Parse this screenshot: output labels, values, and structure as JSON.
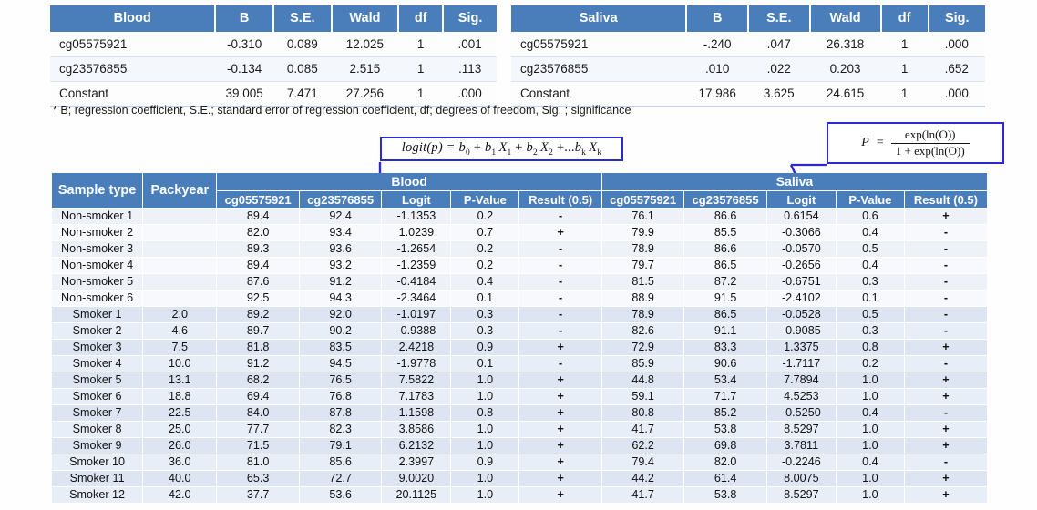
{
  "top_tables": [
    {
      "id": "blood",
      "headers": [
        "Blood",
        "B",
        "S.E.",
        "Wald",
        "df",
        "Sig."
      ],
      "rows": [
        [
          "cg05575921",
          "-0.310",
          "0.089",
          "12.025",
          "1",
          ".001"
        ],
        [
          "cg23576855",
          "-0.134",
          "0.085",
          "2.515",
          "1",
          ".113"
        ],
        [
          "Constant",
          "39.005",
          "7.471",
          "27.256",
          "1",
          ".000"
        ]
      ]
    },
    {
      "id": "saliva",
      "headers": [
        "Saliva",
        "B",
        "S.E.",
        "Wald",
        "df",
        "Sig."
      ],
      "rows": [
        [
          "cg05575921",
          "-.240",
          ".047",
          "26.318",
          "1",
          ".000"
        ],
        [
          "cg23576855",
          ".010",
          ".022",
          "0.203",
          "1",
          ".652"
        ],
        [
          "Constant",
          "17.986",
          "3.625",
          "24.615",
          "1",
          ".000"
        ]
      ]
    }
  ],
  "footnote": "* B; regression coefficient, S.E.; standard error of regression coefficient, df; degrees of freedom, Sig. ; significance",
  "formulas": {
    "logit": {
      "label": "logit(p) = b0 + b1 X1 + b2 X2 + ...bk Xk",
      "lhs": "logit(",
      "p": "p",
      "rhs": ") =",
      "b0": "b",
      "b0s": "0",
      "b1": "b",
      "b1s": "1",
      "x1": "X",
      "x1s": "1",
      "b2": "b",
      "b2s": "2",
      "x2": "X",
      "x2s": "2",
      "tail": "+...",
      "bk": "b",
      "bks": "k",
      "xk": "X",
      "xks": "k"
    },
    "probability": {
      "label": "P = exp(ln(O)) / (1 + exp(ln(O)))",
      "lhs": "P",
      "eq": "=",
      "numerator": "exp(ln(O))",
      "denominator": "1 + exp(ln(O))"
    }
  },
  "main_table": {
    "group_headers": {
      "sample_type": "Sample type",
      "packyear": "Packyear",
      "blood": "Blood",
      "saliva": "Saliva"
    },
    "sub_headers": [
      "cg05575921",
      "cg23576855",
      "Logit",
      "P-Value",
      "Result (0.5)"
    ],
    "rows": [
      {
        "sample": "Non-smoker 1",
        "packyear": "",
        "blood": {
          "cg05575921": "89.4",
          "cg23576855": "92.4",
          "logit": "-1.1353",
          "pvalue": "0.2",
          "result": "-"
        },
        "saliva": {
          "cg05575921": "76.1",
          "cg23576855": "86.6",
          "logit": "0.6154",
          "pvalue": "0.6",
          "result": "+"
        }
      },
      {
        "sample": "Non-smoker 2",
        "packyear": "",
        "blood": {
          "cg05575921": "82.0",
          "cg23576855": "93.4",
          "logit": "1.0239",
          "pvalue": "0.7",
          "result": "+"
        },
        "saliva": {
          "cg05575921": "79.9",
          "cg23576855": "85.5",
          "logit": "-0.3066",
          "pvalue": "0.4",
          "result": "-"
        }
      },
      {
        "sample": "Non-smoker 3",
        "packyear": "",
        "blood": {
          "cg05575921": "89.3",
          "cg23576855": "93.6",
          "logit": "-1.2654",
          "pvalue": "0.2",
          "result": "-"
        },
        "saliva": {
          "cg05575921": "78.9",
          "cg23576855": "86.6",
          "logit": "-0.0570",
          "pvalue": "0.5",
          "result": "-"
        }
      },
      {
        "sample": "Non-smoker 4",
        "packyear": "",
        "blood": {
          "cg05575921": "89.4",
          "cg23576855": "93.2",
          "logit": "-1.2359",
          "pvalue": "0.2",
          "result": "-"
        },
        "saliva": {
          "cg05575921": "79.7",
          "cg23576855": "86.5",
          "logit": "-0.2656",
          "pvalue": "0.4",
          "result": "-"
        }
      },
      {
        "sample": "Non-smoker 5",
        "packyear": "",
        "blood": {
          "cg05575921": "87.6",
          "cg23576855": "91.2",
          "logit": "-0.4184",
          "pvalue": "0.4",
          "result": "-"
        },
        "saliva": {
          "cg05575921": "81.5",
          "cg23576855": "87.2",
          "logit": "-0.6751",
          "pvalue": "0.3",
          "result": "-"
        }
      },
      {
        "sample": "Non-smoker 6",
        "packyear": "",
        "blood": {
          "cg05575921": "92.5",
          "cg23576855": "94.3",
          "logit": "-2.3464",
          "pvalue": "0.1",
          "result": "-"
        },
        "saliva": {
          "cg05575921": "88.9",
          "cg23576855": "91.5",
          "logit": "-2.4102",
          "pvalue": "0.1",
          "result": "-"
        }
      },
      {
        "sample": "Smoker 1",
        "packyear": "2.0",
        "blood": {
          "cg05575921": "89.2",
          "cg23576855": "92.0",
          "logit": "-1.0197",
          "pvalue": "0.3",
          "result": "-"
        },
        "saliva": {
          "cg05575921": "78.9",
          "cg23576855": "86.5",
          "logit": "-0.0528",
          "pvalue": "0.5",
          "result": "-"
        }
      },
      {
        "sample": "Smoker 2",
        "packyear": "4.6",
        "blood": {
          "cg05575921": "89.7",
          "cg23576855": "90.2",
          "logit": "-0.9388",
          "pvalue": "0.3",
          "result": "-"
        },
        "saliva": {
          "cg05575921": "82.6",
          "cg23576855": "91.1",
          "logit": "-0.9085",
          "pvalue": "0.3",
          "result": "-"
        }
      },
      {
        "sample": "Smoker 3",
        "packyear": "7.5",
        "blood": {
          "cg05575921": "81.8",
          "cg23576855": "83.5",
          "logit": "2.4218",
          "pvalue": "0.9",
          "result": "+"
        },
        "saliva": {
          "cg05575921": "72.9",
          "cg23576855": "83.3",
          "logit": "1.3375",
          "pvalue": "0.8",
          "result": "+"
        }
      },
      {
        "sample": "Smoker 4",
        "packyear": "10.0",
        "blood": {
          "cg05575921": "91.2",
          "cg23576855": "94.5",
          "logit": "-1.9778",
          "pvalue": "0.1",
          "result": "-"
        },
        "saliva": {
          "cg05575921": "85.9",
          "cg23576855": "90.6",
          "logit": "-1.7117",
          "pvalue": "0.2",
          "result": "-"
        }
      },
      {
        "sample": "Smoker 5",
        "packyear": "13.1",
        "blood": {
          "cg05575921": "68.2",
          "cg23576855": "76.5",
          "logit": "7.5822",
          "pvalue": "1.0",
          "result": "+"
        },
        "saliva": {
          "cg05575921": "44.8",
          "cg23576855": "53.4",
          "logit": "7.7894",
          "pvalue": "1.0",
          "result": "+"
        }
      },
      {
        "sample": "Smoker 6",
        "packyear": "18.8",
        "blood": {
          "cg05575921": "69.4",
          "cg23576855": "76.8",
          "logit": "7.1783",
          "pvalue": "1.0",
          "result": "+"
        },
        "saliva": {
          "cg05575921": "59.1",
          "cg23576855": "71.7",
          "logit": "4.5253",
          "pvalue": "1.0",
          "result": "+"
        }
      },
      {
        "sample": "Smoker 7",
        "packyear": "22.5",
        "blood": {
          "cg05575921": "84.0",
          "cg23576855": "87.8",
          "logit": "1.1598",
          "pvalue": "0.8",
          "result": "+"
        },
        "saliva": {
          "cg05575921": "80.8",
          "cg23576855": "85.2",
          "logit": "-0.5250",
          "pvalue": "0.4",
          "result": "-"
        }
      },
      {
        "sample": "Smoker 8",
        "packyear": "25.0",
        "blood": {
          "cg05575921": "77.7",
          "cg23576855": "82.3",
          "logit": "3.8586",
          "pvalue": "1.0",
          "result": "+"
        },
        "saliva": {
          "cg05575921": "41.7",
          "cg23576855": "53.8",
          "logit": "8.5297",
          "pvalue": "1.0",
          "result": "+"
        }
      },
      {
        "sample": "Smoker 9",
        "packyear": "26.0",
        "blood": {
          "cg05575921": "71.5",
          "cg23576855": "79.1",
          "logit": "6.2132",
          "pvalue": "1.0",
          "result": "+"
        },
        "saliva": {
          "cg05575921": "62.2",
          "cg23576855": "69.8",
          "logit": "3.7811",
          "pvalue": "1.0",
          "result": "+"
        }
      },
      {
        "sample": "Smoker 10",
        "packyear": "36.0",
        "blood": {
          "cg05575921": "81.0",
          "cg23576855": "85.6",
          "logit": "2.3997",
          "pvalue": "0.9",
          "result": "+"
        },
        "saliva": {
          "cg05575921": "79.4",
          "cg23576855": "82.0",
          "logit": "-0.2246",
          "pvalue": "0.4",
          "result": "-"
        }
      },
      {
        "sample": "Smoker 11",
        "packyear": "40.0",
        "blood": {
          "cg05575921": "65.3",
          "cg23576855": "72.7",
          "logit": "9.0020",
          "pvalue": "1.0",
          "result": "+"
        },
        "saliva": {
          "cg05575921": "44.2",
          "cg23576855": "61.4",
          "logit": "8.0075",
          "pvalue": "1.0",
          "result": "+"
        }
      },
      {
        "sample": "Smoker 12",
        "packyear": "42.0",
        "blood": {
          "cg05575921": "37.7",
          "cg23576855": "53.6",
          "logit": "20.1125",
          "pvalue": "1.0",
          "result": "+"
        },
        "saliva": {
          "cg05575921": "41.7",
          "cg23576855": "53.8",
          "logit": "8.5297",
          "pvalue": "1.0",
          "result": "+"
        }
      }
    ]
  },
  "colors": {
    "header_blue": "#4a7ebb",
    "arrow_blue": "#2a2ad0",
    "row_light": "#f7f9fc",
    "row_dark": "#dde5f3"
  },
  "annotations": {
    "arrow_blood_logit": "down-arrow pointing to Blood Logit column",
    "arrow_saliva_pvalue": "down-arrow pointing to Saliva P-Value column"
  }
}
